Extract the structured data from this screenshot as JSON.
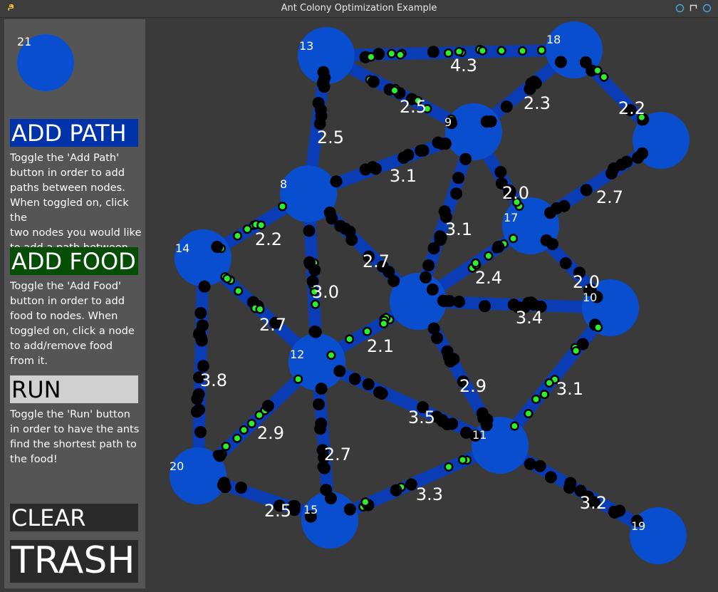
{
  "window": {
    "title": "Ant Colony Optimization Example",
    "icons": {
      "app": "python-icon",
      "buttons": [
        "restore-icon",
        "maximize-icon",
        "close-icon"
      ]
    }
  },
  "sidebar": {
    "swatch_label": "21",
    "buttons": {
      "add_path": {
        "label": "ADD PATH",
        "bg": "#0033aa",
        "fg": "#ffffff"
      },
      "add_food": {
        "label": "ADD FOOD",
        "bg": "#064d06",
        "fg": "#ffffff"
      },
      "run": {
        "label": "RUN",
        "bg": "#d0d0d0",
        "fg": "#000000"
      },
      "clear": {
        "label": "CLEAR",
        "bg": "#2a2a2a",
        "fg": "#ffffff"
      },
      "trash": {
        "label": "TRASH",
        "bg": "#2a2a2a",
        "fg": "#ffffff"
      }
    },
    "help": {
      "add_path": [
        "Toggle the 'Add Path'",
        "button in order to add",
        "paths between nodes.",
        "When toggled on, click the",
        "two nodes you would like",
        "to add a path between."
      ],
      "add_food": [
        "Toggle the 'Add Food'",
        "button in order to add",
        "food to nodes. When",
        "toggled on, click a node",
        "to add/remove food",
        "from it."
      ],
      "run": [
        "Toggle the 'Run' button",
        "in order to have the ants",
        "find the shortest path to",
        "the food!"
      ]
    }
  },
  "graph": {
    "colors": {
      "node": "#0a4ed0",
      "edge": "#0a3db5",
      "ant": "#000000",
      "food_ant": "#2df02d",
      "label": "#ffffff"
    },
    "nodes": [
      {
        "id": "13",
        "label": "13"
      },
      {
        "id": "18",
        "label": "18"
      },
      {
        "id": "9",
        "label": "9"
      },
      {
        "id": "R",
        "label": ""
      },
      {
        "id": "8",
        "label": "8"
      },
      {
        "id": "17",
        "label": "17"
      },
      {
        "id": "14",
        "label": "14"
      },
      {
        "id": "C",
        "label": ""
      },
      {
        "id": "10",
        "label": "10"
      },
      {
        "id": "12",
        "label": "12"
      },
      {
        "id": "11",
        "label": "11"
      },
      {
        "id": "20",
        "label": "20"
      },
      {
        "id": "15",
        "label": "15"
      },
      {
        "id": "19",
        "label": "19"
      }
    ],
    "edges": [
      {
        "from": "13",
        "to": "18",
        "weight": "4.3"
      },
      {
        "from": "13",
        "to": "9",
        "weight": "2.5"
      },
      {
        "from": "18",
        "to": "9",
        "weight": "2.3"
      },
      {
        "from": "18",
        "to": "R",
        "weight": "2.2"
      },
      {
        "from": "13",
        "to": "8",
        "weight": "2.5"
      },
      {
        "from": "8",
        "to": "9",
        "weight": "3.1"
      },
      {
        "from": "9",
        "to": "17",
        "weight": "2.0"
      },
      {
        "from": "9",
        "to": "C",
        "weight": "3.1"
      },
      {
        "from": "R",
        "to": "17",
        "weight": "2.7"
      },
      {
        "from": "14",
        "to": "8",
        "weight": "2.2"
      },
      {
        "from": "8",
        "to": "C",
        "weight": "2.7"
      },
      {
        "from": "8",
        "to": "12",
        "weight": "3.0"
      },
      {
        "from": "17",
        "to": "C",
        "weight": "2.4"
      },
      {
        "from": "17",
        "to": "10",
        "weight": "2.0"
      },
      {
        "from": "C",
        "to": "10",
        "weight": "3.4"
      },
      {
        "from": "14",
        "to": "12",
        "weight": "2.7"
      },
      {
        "from": "12",
        "to": "C",
        "weight": "2.1"
      },
      {
        "from": "C",
        "to": "11",
        "weight": "2.9"
      },
      {
        "from": "10",
        "to": "11",
        "weight": "3.1"
      },
      {
        "from": "14",
        "to": "20",
        "weight": "3.8"
      },
      {
        "from": "12",
        "to": "11",
        "weight": "3.5"
      },
      {
        "from": "20",
        "to": "12",
        "weight": "2.9"
      },
      {
        "from": "12",
        "to": "15",
        "weight": "2.7"
      },
      {
        "from": "20",
        "to": "15",
        "weight": "2.5"
      },
      {
        "from": "15",
        "to": "11",
        "weight": "3.3"
      },
      {
        "from": "11",
        "to": "19",
        "weight": "3.2"
      }
    ]
  }
}
